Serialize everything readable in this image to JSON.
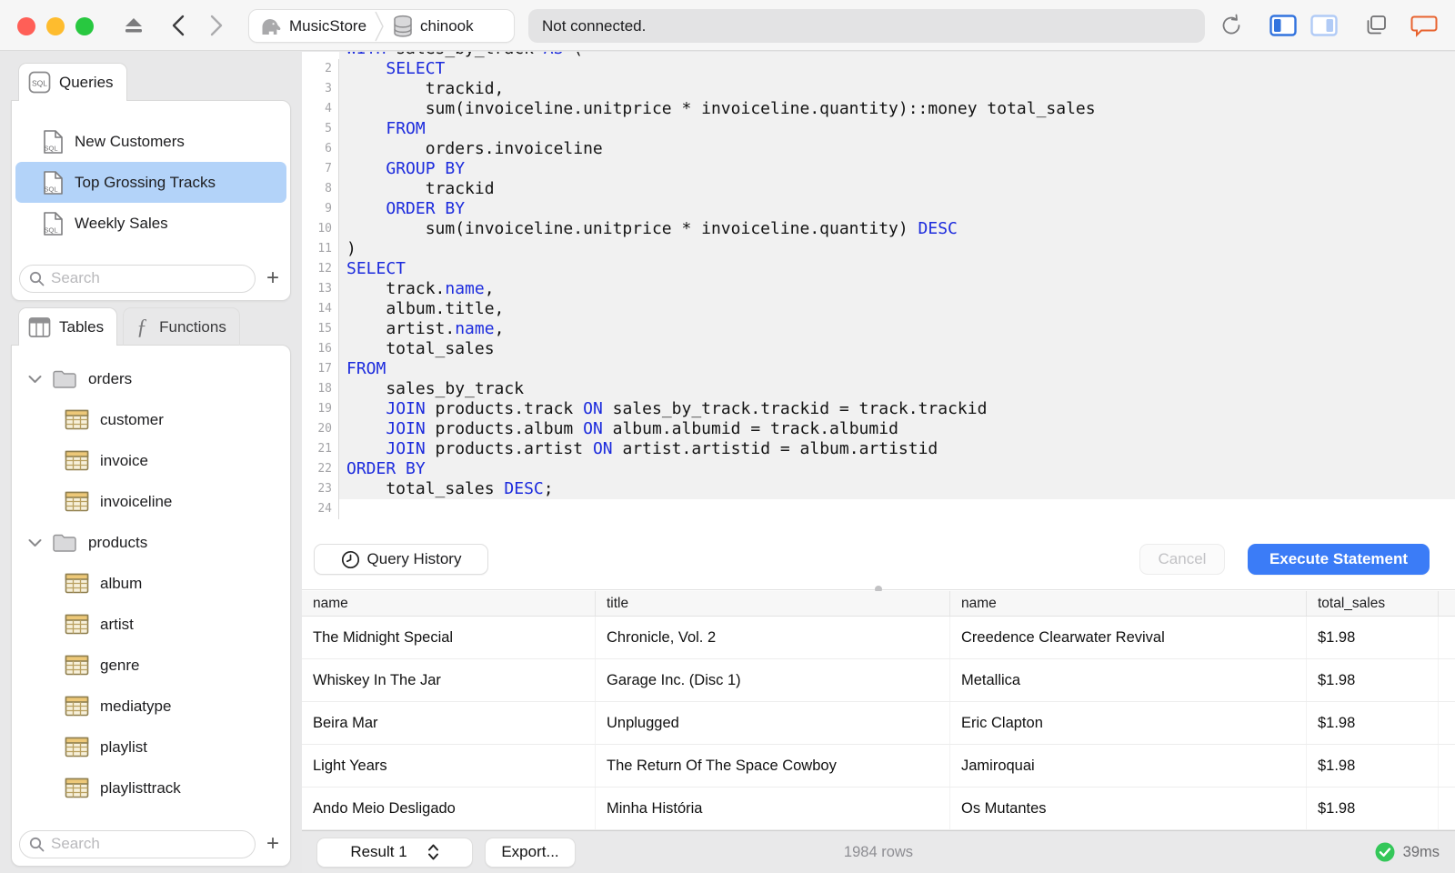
{
  "colors": {
    "accent_blue": "#3b7cf7",
    "selection_blue": "#b3d3f9",
    "keyword_blue": "#1c2bdd",
    "success_green": "#34c759",
    "chat_orange": "#e8632f",
    "table_icon_tan": "#edc878",
    "statement_highlight": "#f1f1f1"
  },
  "toolbar": {
    "breadcrumb": {
      "server": "MusicStore",
      "database": "chinook"
    },
    "status": "Not connected.",
    "icons": [
      "eject",
      "back",
      "forward",
      "refresh",
      "toggle-left-panel",
      "toggle-right-panel",
      "windows",
      "chat"
    ]
  },
  "sidebar": {
    "queries_panel": {
      "tab_label": "Queries",
      "items": [
        {
          "label": "New Customers",
          "selected": false
        },
        {
          "label": "Top Grossing Tracks",
          "selected": true
        },
        {
          "label": "Weekly Sales",
          "selected": false
        }
      ],
      "search_placeholder": "Search",
      "add_label": "+"
    },
    "schema_panel": {
      "tabs": [
        {
          "label": "Tables",
          "active": true
        },
        {
          "label": "Functions",
          "active": false
        }
      ],
      "tree": [
        {
          "type": "folder",
          "label": "orders"
        },
        {
          "type": "table",
          "label": "customer"
        },
        {
          "type": "table",
          "label": "invoice"
        },
        {
          "type": "table",
          "label": "invoiceline"
        },
        {
          "type": "folder",
          "label": "products"
        },
        {
          "type": "table",
          "label": "album"
        },
        {
          "type": "table",
          "label": "artist"
        },
        {
          "type": "table",
          "label": "genre"
        },
        {
          "type": "table",
          "label": "mediatype"
        },
        {
          "type": "table",
          "label": "playlist"
        },
        {
          "type": "table",
          "label": "playlisttrack"
        }
      ],
      "search_placeholder": "Search",
      "add_label": "+"
    }
  },
  "editor": {
    "highlight_last_line": 23,
    "lines": [
      {
        "n": 1,
        "segs": [
          [
            "WITH",
            1
          ],
          [
            " sales_by_track ",
            0
          ],
          [
            "AS",
            1
          ],
          [
            " (",
            0
          ]
        ]
      },
      {
        "n": 2,
        "segs": [
          [
            "    ",
            0
          ],
          [
            "SELECT",
            1
          ]
        ]
      },
      {
        "n": 3,
        "segs": [
          [
            "        trackid,",
            0
          ]
        ]
      },
      {
        "n": 4,
        "segs": [
          [
            "        sum(invoiceline.unitprice * invoiceline.quantity)::money total_sales",
            0
          ]
        ]
      },
      {
        "n": 5,
        "segs": [
          [
            "    ",
            0
          ],
          [
            "FROM",
            1
          ]
        ]
      },
      {
        "n": 6,
        "segs": [
          [
            "        orders.invoiceline",
            0
          ]
        ]
      },
      {
        "n": 7,
        "segs": [
          [
            "    ",
            0
          ],
          [
            "GROUP BY",
            1
          ]
        ]
      },
      {
        "n": 8,
        "segs": [
          [
            "        trackid",
            0
          ]
        ]
      },
      {
        "n": 9,
        "segs": [
          [
            "    ",
            0
          ],
          [
            "ORDER BY",
            1
          ]
        ]
      },
      {
        "n": 10,
        "segs": [
          [
            "        sum(invoiceline.unitprice * invoiceline.quantity) ",
            0
          ],
          [
            "DESC",
            1
          ]
        ]
      },
      {
        "n": 11,
        "segs": [
          [
            ")",
            0
          ]
        ]
      },
      {
        "n": 12,
        "segs": [
          [
            "SELECT",
            1
          ]
        ]
      },
      {
        "n": 13,
        "segs": [
          [
            "    track.",
            0
          ],
          [
            "name",
            1
          ],
          [
            ",",
            0
          ]
        ]
      },
      {
        "n": 14,
        "segs": [
          [
            "    album.title,",
            0
          ]
        ]
      },
      {
        "n": 15,
        "segs": [
          [
            "    artist.",
            0
          ],
          [
            "name",
            1
          ],
          [
            ",",
            0
          ]
        ]
      },
      {
        "n": 16,
        "segs": [
          [
            "    total_sales",
            0
          ]
        ]
      },
      {
        "n": 17,
        "segs": [
          [
            "FROM",
            1
          ]
        ]
      },
      {
        "n": 18,
        "segs": [
          [
            "    sales_by_track",
            0
          ]
        ]
      },
      {
        "n": 19,
        "segs": [
          [
            "    ",
            0
          ],
          [
            "JOIN",
            1
          ],
          [
            " products.track ",
            0
          ],
          [
            "ON",
            1
          ],
          [
            " sales_by_track.trackid = track.trackid",
            0
          ]
        ]
      },
      {
        "n": 20,
        "segs": [
          [
            "    ",
            0
          ],
          [
            "JOIN",
            1
          ],
          [
            " products.album ",
            0
          ],
          [
            "ON",
            1
          ],
          [
            " album.albumid = track.albumid",
            0
          ]
        ]
      },
      {
        "n": 21,
        "segs": [
          [
            "    ",
            0
          ],
          [
            "JOIN",
            1
          ],
          [
            " products.artist ",
            0
          ],
          [
            "ON",
            1
          ],
          [
            " artist.artistid = album.artistid",
            0
          ]
        ]
      },
      {
        "n": 22,
        "segs": [
          [
            "ORDER BY",
            1
          ]
        ]
      },
      {
        "n": 23,
        "segs": [
          [
            "    total_sales ",
            0
          ],
          [
            "DESC",
            1
          ],
          [
            ";",
            0
          ]
        ]
      },
      {
        "n": 24,
        "segs": []
      }
    ],
    "buttons": {
      "query_history": "Query History",
      "cancel": "Cancel",
      "execute": "Execute Statement"
    }
  },
  "results": {
    "columns": [
      "name",
      "title",
      "name",
      "total_sales"
    ],
    "rows": [
      [
        "The Midnight Special",
        "Chronicle, Vol. 2",
        "Creedence Clearwater Revival",
        "$1.98"
      ],
      [
        "Whiskey In The Jar",
        "Garage Inc. (Disc 1)",
        "Metallica",
        "$1.98"
      ],
      [
        "Beira Mar",
        "Unplugged",
        "Eric Clapton",
        "$1.98"
      ],
      [
        "Light Years",
        "The Return Of The Space Cowboy",
        "Jamiroquai",
        "$1.98"
      ],
      [
        "Ando Meio Desligado",
        "Minha História",
        "Os Mutantes",
        "$1.98"
      ]
    ],
    "footer": {
      "result_selector": "Result 1",
      "export_label": "Export...",
      "row_count": "1984 rows",
      "duration": "39ms"
    }
  }
}
